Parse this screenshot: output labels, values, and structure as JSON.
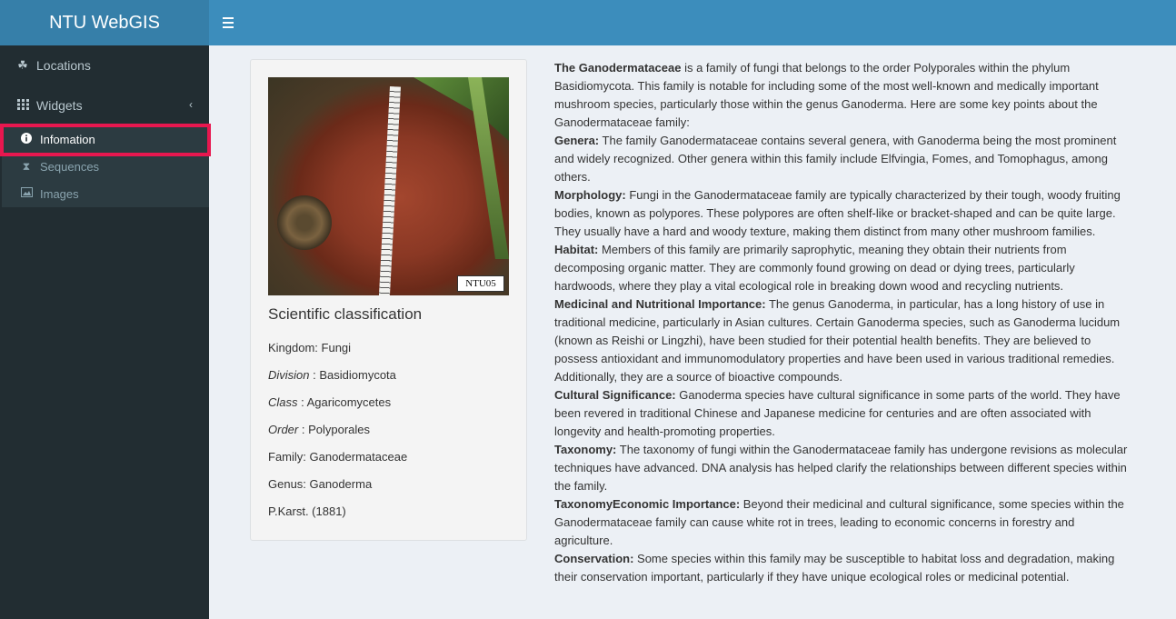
{
  "app": {
    "title": "NTU WebGIS"
  },
  "sidebar": {
    "items": [
      {
        "label": "Locations",
        "icon": "leaf-icon"
      },
      {
        "label": "Widgets",
        "icon": "grid-icon"
      }
    ],
    "submenu": [
      {
        "label": "Infomation",
        "icon": "info-icon",
        "active": true
      },
      {
        "label": "Sequences",
        "icon": "hourglass-icon"
      },
      {
        "label": "Images",
        "icon": "image-icon"
      }
    ]
  },
  "photo": {
    "label": "NTU05"
  },
  "classification": {
    "title": "Scientific classification",
    "kingdom": "Kingdom: Fungi",
    "division_key": "Division",
    "division_val": " : Basidiomycota",
    "class_key": "Class",
    "class_val": " : Agaricomycetes",
    "order_key": "Order",
    "order_val": " : Polyporales",
    "family": "Family: Ganodermataceae",
    "genus": "Genus: Ganoderma",
    "authority": "P.Karst. (1881)"
  },
  "description": {
    "intro_title": "The Ganodermataceae",
    "intro_text": " is a family of fungi that belongs to the order Polyporales within the phylum Basidiomycota. This family is notable for including some of the most well-known and medically important mushroom species, particularly those within the genus Ganoderma. Here are some key points about the Ganodermataceae family:",
    "sections": [
      {
        "title": "Genera:",
        "text": " The family Ganodermataceae contains several genera, with Ganoderma being the most prominent and widely recognized. Other genera within this family include Elfvingia, Fomes, and Tomophagus, among others."
      },
      {
        "title": "Morphology:",
        "text": " Fungi in the Ganodermataceae family are typically characterized by their tough, woody fruiting bodies, known as polypores. These polypores are often shelf-like or bracket-shaped and can be quite large. They usually have a hard and woody texture, making them distinct from many other mushroom families."
      },
      {
        "title": "Habitat:",
        "text": " Members of this family are primarily saprophytic, meaning they obtain their nutrients from decomposing organic matter. They are commonly found growing on dead or dying trees, particularly hardwoods, where they play a vital ecological role in breaking down wood and recycling nutrients."
      },
      {
        "title": "Medicinal and Nutritional Importance:",
        "text": " The genus Ganoderma, in particular, has a long history of use in traditional medicine, particularly in Asian cultures. Certain Ganoderma species, such as Ganoderma lucidum (known as Reishi or Lingzhi), have been studied for their potential health benefits. They are believed to possess antioxidant and immunomodulatory properties and have been used in various traditional remedies. Additionally, they are a source of bioactive compounds."
      },
      {
        "title": "Cultural Significance:",
        "text": " Ganoderma species have cultural significance in some parts of the world. They have been revered in traditional Chinese and Japanese medicine for centuries and are often associated with longevity and health-promoting properties."
      },
      {
        "title": "Taxonomy:",
        "text": " The taxonomy of fungi within the Ganodermataceae family has undergone revisions as molecular techniques have advanced. DNA analysis has helped clarify the relationships between different species within the family."
      },
      {
        "title": "TaxonomyEconomic Importance:",
        "text": " Beyond their medicinal and cultural significance, some species within the Ganodermataceae family can cause white rot in trees, leading to economic concerns in forestry and agriculture."
      },
      {
        "title": "Conservation:",
        "text": " Some species within this family may be susceptible to habitat loss and degradation, making their conservation important, particularly if they have unique ecological roles or medicinal potential."
      }
    ]
  }
}
